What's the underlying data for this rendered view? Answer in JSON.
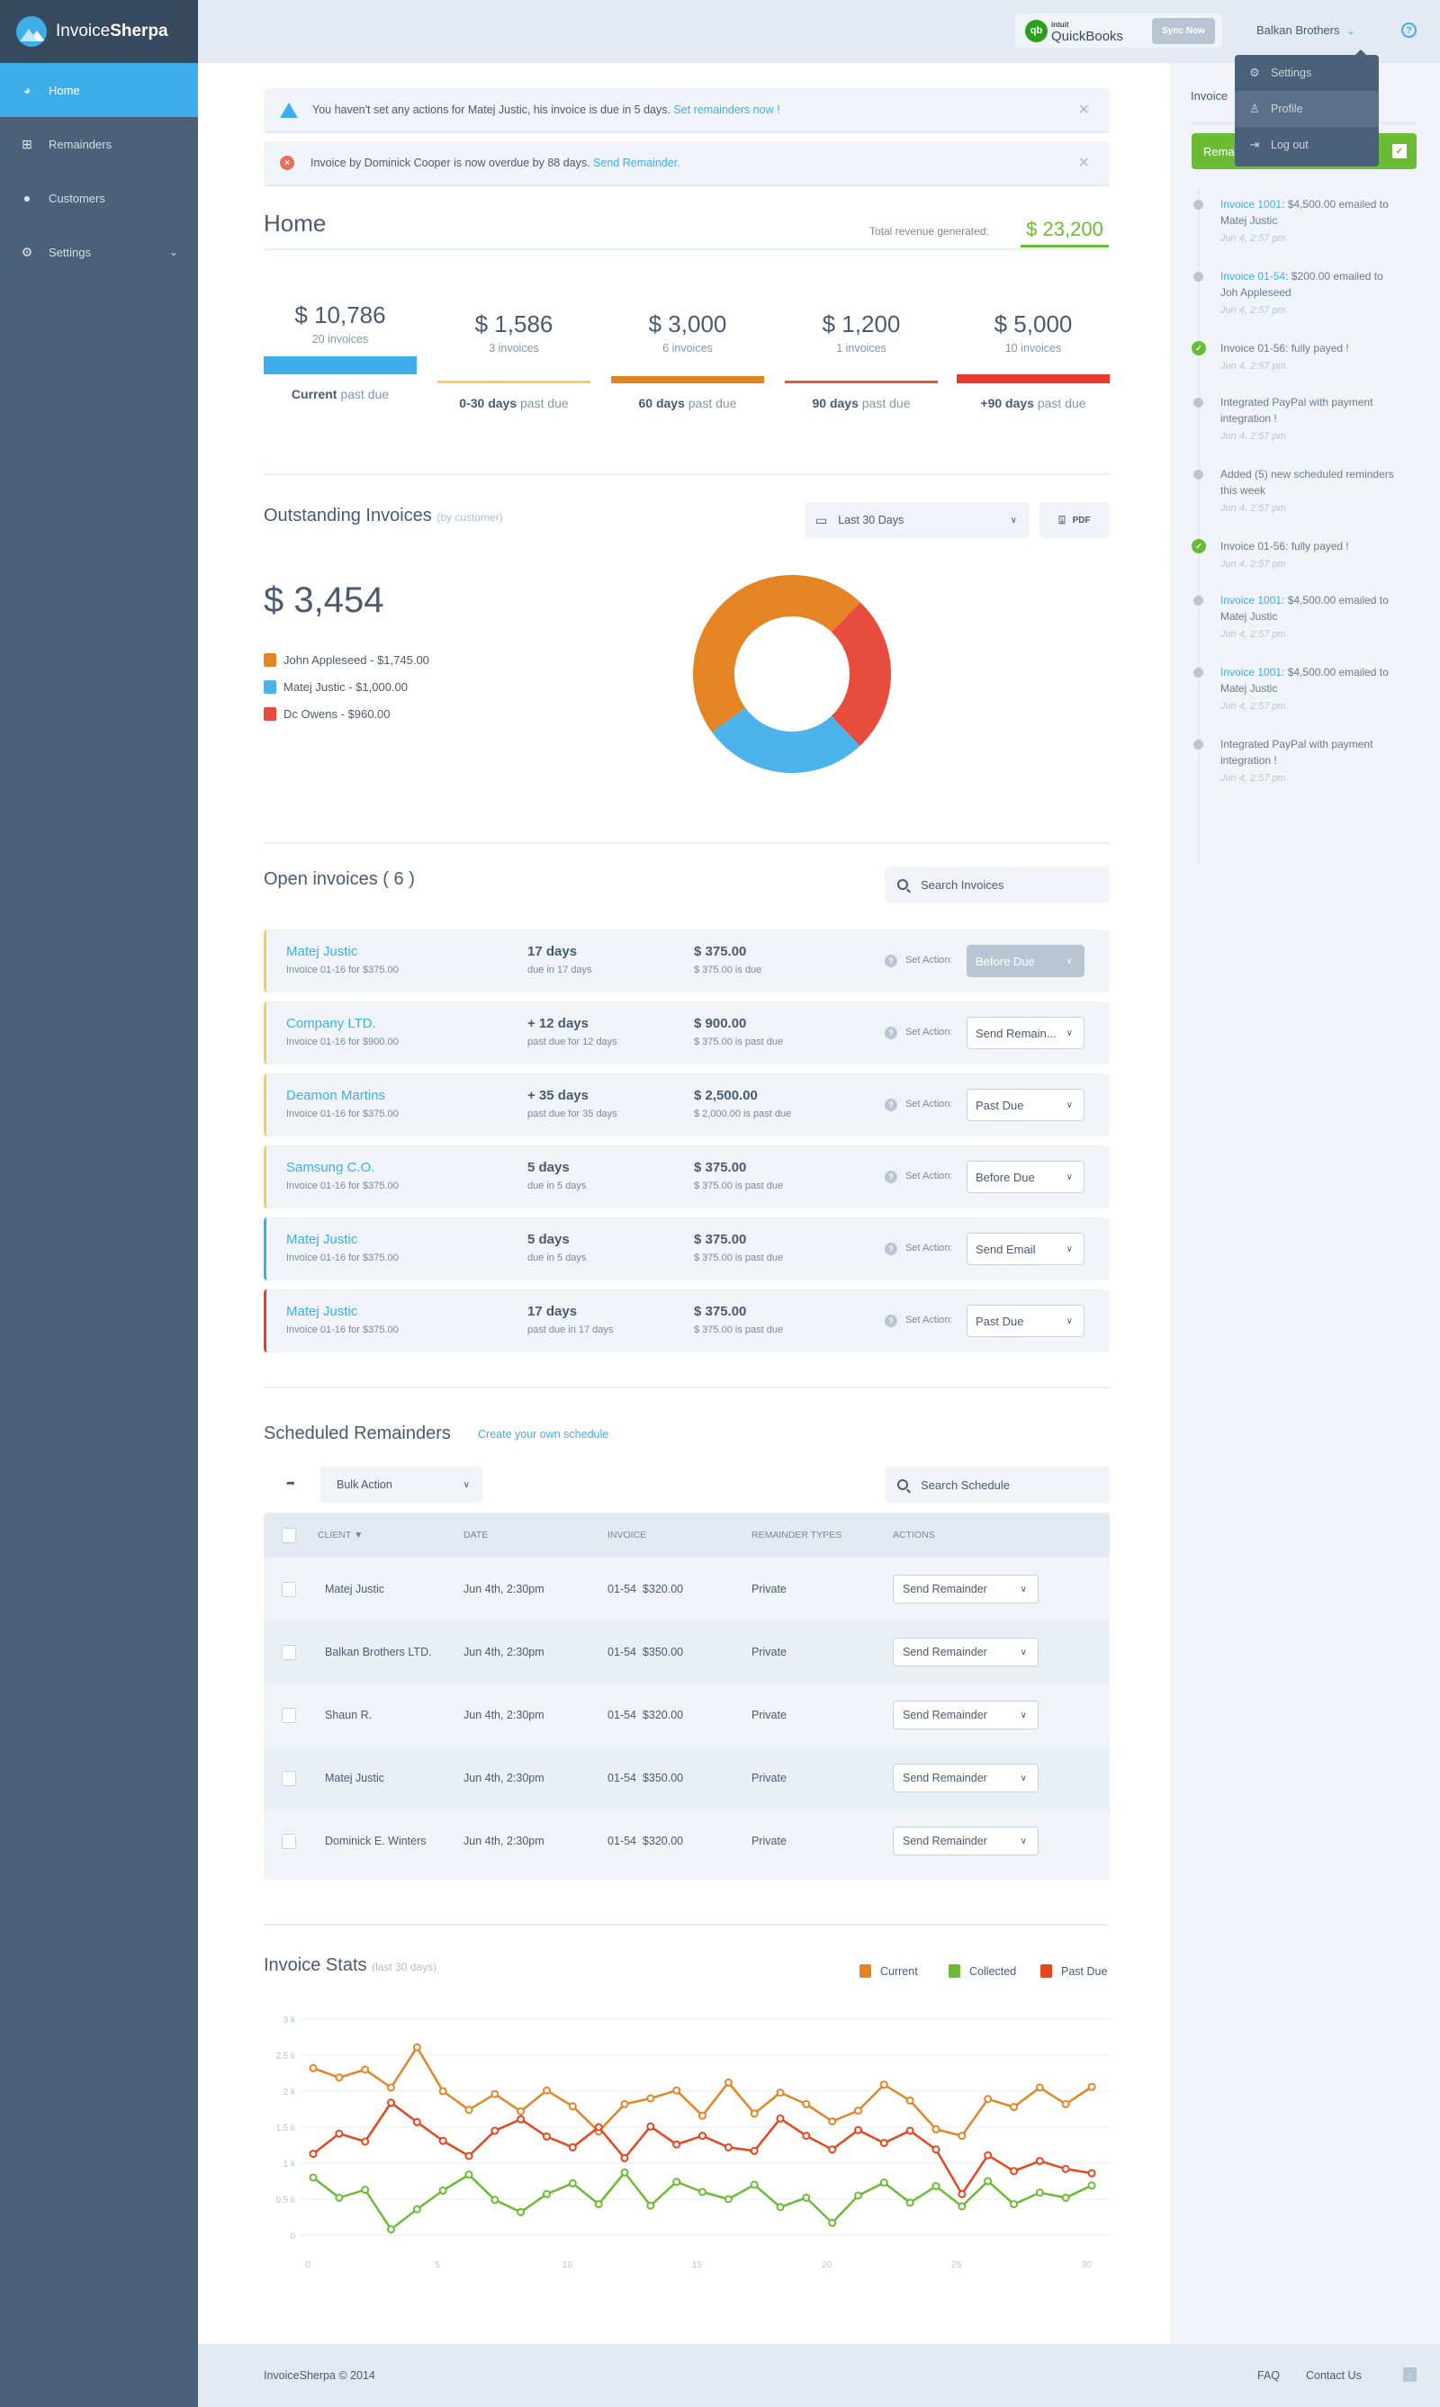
{
  "app": {
    "name_light": "Invoice",
    "name_bold": "Sherpa"
  },
  "sidebar": {
    "items": [
      {
        "label": "Home",
        "icon": "dashboard-icon",
        "active": true
      },
      {
        "label": "Remainders",
        "icon": "inbox-icon"
      },
      {
        "label": "Customers",
        "icon": "user-icon"
      },
      {
        "label": "Settings",
        "icon": "gear-icon",
        "has_submenu": true
      }
    ]
  },
  "topbar": {
    "quickbooks_small": "intuit",
    "quickbooks": "QuickBooks",
    "qb_glyph": "qb",
    "sync_label": "Sync Now",
    "user_name": "Balkan Brothers",
    "help": "?"
  },
  "user_menu": {
    "items": [
      {
        "label": "Settings",
        "icon": "gear-icon"
      },
      {
        "label": "Profile",
        "icon": "user-icon",
        "hover": true
      },
      {
        "label": "Log out",
        "icon": "logout-icon"
      }
    ]
  },
  "alerts": [
    {
      "type": "warning",
      "text": "You haven't set any actions for Matej Justic, his invoice is due in 5 days. ",
      "link": "Set remainders now !"
    },
    {
      "type": "error",
      "text": "Invoice by Dominick Cooper is now overdue by 88 days. ",
      "link": "Send Remainder."
    }
  ],
  "home": {
    "title": "Home",
    "revenue_label": "Total revenue generated:",
    "revenue_value": "$ 23,200",
    "buckets": [
      {
        "amount": "$ 10,786",
        "count": "20 invoices",
        "bold": "Current",
        "rest": " past due",
        "color": "#3daee9"
      },
      {
        "amount": "$ 1,586",
        "count": "3 invoices",
        "bold": "0-30 days",
        "rest": " past due",
        "color": "#f2ce5c"
      },
      {
        "amount": "$ 3,000",
        "count": "6 invoices",
        "bold": "60 days",
        "rest": " past due",
        "color": "#e58425"
      },
      {
        "amount": "$ 1,200",
        "count": "1 invoices",
        "bold": "90 days",
        "rest": " past due",
        "color": "#e85a32"
      },
      {
        "amount": "$ 5,000",
        "count": "10 invoices",
        "bold": "+90 days",
        "rest": " past due",
        "color": "#e8392b"
      }
    ]
  },
  "outstanding": {
    "title": "Outstanding Invoices",
    "subtitle": "(by customer)",
    "range_label": "Last 30 Days",
    "pdf_label": "PDF",
    "total": "$ 3,454",
    "legend": [
      {
        "label": "John Appleseed - $1,745.00",
        "color": "#e58425"
      },
      {
        "label": "Matej Justic - $1,000.00",
        "color": "#4cb4ea"
      },
      {
        "label": "Dc Owens - $960.00",
        "color": "#e84c3d"
      }
    ]
  },
  "chart_data": [
    {
      "type": "pie",
      "title": "Outstanding Invoices (by customer)",
      "donut": true,
      "categories": [
        "John Appleseed",
        "Matej Justic",
        "Dc Owens"
      ],
      "values": [
        1745,
        1000,
        960
      ],
      "colors": [
        "#e58425",
        "#4cb4ea",
        "#e84c3d"
      ]
    },
    {
      "type": "line",
      "title": "Invoice Stats",
      "subtitle": "(last 30 days)",
      "legend_position": "top-right",
      "x": [
        0,
        1,
        2,
        3,
        4,
        5,
        6,
        7,
        8,
        9,
        10,
        11,
        12,
        13,
        14,
        15,
        16,
        17,
        18,
        19,
        20,
        21,
        22,
        23,
        24,
        25,
        26,
        27,
        28,
        29,
        30
      ],
      "xticks": [
        "0",
        "5",
        "10",
        "15",
        "20",
        "25",
        "30"
      ],
      "yticks": [
        "0",
        "0.5 k",
        "1 k",
        "1.5 k",
        "2 k",
        "2.5 k",
        "3 k"
      ],
      "ylim": [
        0,
        3000
      ],
      "grid": true,
      "series": [
        {
          "name": "Current",
          "color": "#e58425",
          "values": [
            2320,
            2190,
            2300,
            2050,
            2610,
            2000,
            1740,
            1960,
            1720,
            2010,
            1790,
            1440,
            1820,
            1900,
            2010,
            1660,
            2120,
            1690,
            1980,
            1820,
            1580,
            1730,
            2090,
            1870,
            1470,
            1380,
            1890,
            1780,
            2050,
            1820,
            2060
          ]
        },
        {
          "name": "Collected",
          "color": "#6cbb35",
          "values": [
            800,
            520,
            630,
            80,
            360,
            620,
            840,
            490,
            320,
            570,
            720,
            430,
            870,
            410,
            740,
            600,
            500,
            700,
            390,
            520,
            170,
            550,
            730,
            450,
            680,
            400,
            750,
            430,
            590,
            520,
            690
          ]
        },
        {
          "name": "Past Due",
          "color": "#e8451e",
          "values": [
            1130,
            1410,
            1300,
            1840,
            1570,
            1310,
            1100,
            1450,
            1610,
            1370,
            1220,
            1500,
            1070,
            1510,
            1260,
            1380,
            1220,
            1170,
            1620,
            1380,
            1190,
            1460,
            1280,
            1450,
            1190,
            570,
            1110,
            890,
            1030,
            920,
            860
          ]
        }
      ]
    }
  ],
  "open_invoices": {
    "title": "Open invoices ( 6 )",
    "search_placeholder": "Search Invoices",
    "set_action_label": "Set Action:",
    "rows": [
      {
        "name": "Matej Justic",
        "sub": "Invoice 01-16 for $375.00",
        "days": "17 days",
        "days_sub": "due in 17 days",
        "amount": "$ 375.00",
        "amount_sub": "$ 375.00 is due",
        "action": "Before Due",
        "disabled": true,
        "accent": "#f2ce5c"
      },
      {
        "name": "Company LTD.",
        "sub": "Invoice 01-16 for $900.00",
        "days": "+ 12 days",
        "days_sub": "past due for 12 days",
        "amount": "$ 900.00",
        "amount_sub": "$ 375.00 is past due",
        "action": "Send Remain...",
        "accent": "#f2ce5c"
      },
      {
        "name": "Deamon Martins",
        "sub": "Invoice 01-16 for $375.00",
        "days": "+ 35 days",
        "days_sub": "past due for 35 days",
        "amount": "$ 2,500.00",
        "amount_sub": "$ 2,000.00 is past due",
        "action": "Past Due",
        "accent": "#f2ce5c"
      },
      {
        "name": "Samsung C.O.",
        "sub": "Invoice 01-16 for $375.00",
        "days": "5 days",
        "days_sub": "due in 5 days",
        "amount": "$ 375.00",
        "amount_sub": "$ 375.00 is past due",
        "action": "Before Due",
        "accent": "#f2ce5c"
      },
      {
        "name": "Matej Justic",
        "sub": "Invoice 01-16 for $375.00",
        "days": "5 days",
        "days_sub": "due in 5 days",
        "amount": "$ 375.00",
        "amount_sub": "$ 375.00 is past due",
        "action": "Send Email",
        "accent": "#3daee9"
      },
      {
        "name": "Matej Justic",
        "sub": "Invoice 01-16 for $375.00",
        "days": "17 days",
        "days_sub": "past due in 17 days",
        "amount": "$ 375.00",
        "amount_sub": "$ 375.00 is past due",
        "action": "Past Due",
        "accent": "#e8392b"
      }
    ]
  },
  "scheduled": {
    "title": "Scheduled Remainders",
    "create_link": "Create your own schedule",
    "bulk_label": "Bulk Action",
    "search_placeholder": "Search Schedule",
    "columns": [
      "CLIENT",
      "DATE",
      "INVOICE",
      "REMAINDER TYPES",
      "ACTIONS"
    ],
    "sort_indicator": "▼",
    "rows": [
      {
        "client": "Matej Justic",
        "date": "Jun 4th, 2:30pm",
        "invoice": "01-54  $320.00",
        "type": "Private",
        "action": "Send Remainder"
      },
      {
        "client": "Balkan Brothers LTD.",
        "date": "Jun 4th, 2:30pm",
        "invoice": "01-54  $350.00",
        "type": "Private",
        "action": "Send Remainder"
      },
      {
        "client": "Shaun R.",
        "date": "Jun 4th, 2:30pm",
        "invoice": "01-54  $320.00",
        "type": "Private",
        "action": "Send Remainder"
      },
      {
        "client": "Matej Justic",
        "date": "Jun 4th, 2:30pm",
        "invoice": "01-54  $350.00",
        "type": "Private",
        "action": "Send Remainder"
      },
      {
        "client": "Dominick E. Winters",
        "date": "Jun 4th, 2:30pm",
        "invoice": "01-54  $320.00",
        "type": "Private",
        "action": "Send Remainder"
      }
    ]
  },
  "stats": {
    "title": "Invoice Stats",
    "subtitle": "(last 30 days)"
  },
  "right_panel": {
    "title": "Invoice",
    "button_label": "Rema",
    "timeline": [
      {
        "link": "Invoice 1001",
        "text": ": $4,500.00 emailed to Matej Justic",
        "time": "Jun 4, 2:57 pm",
        "status": "dot"
      },
      {
        "link": "Invoice 01-54",
        "text": ": $200.00 emailed to Joh Appleseed",
        "time": "Jun 4, 2:57 pm",
        "status": "dot"
      },
      {
        "link": "",
        "text": "Invoice 01-56: fully payed !",
        "time": "Jun 4, 2:57 pm",
        "status": "ok"
      },
      {
        "link": "",
        "text": "Integrated PayPal with payment integration !",
        "time": "Jun 4, 2:57 pm",
        "status": "dot"
      },
      {
        "link": "",
        "text": "Added (5) new scheduled reminders this week",
        "time": "Jun 4, 2:57 pm",
        "status": "dot"
      },
      {
        "link": "",
        "text": "Invoice 01-56: fully payed !",
        "time": "Jun 4, 2:57 pm",
        "status": "ok"
      },
      {
        "link": "Invoice 1001",
        "text": ": $4,500.00 emailed to Matej Justic",
        "time": "Jun 4, 2:57 pm",
        "status": "dot"
      },
      {
        "link": "Invoice 1001",
        "text": ": $4,500.00 emailed to Matej Justic",
        "time": "Jun 4, 2:57 pm",
        "status": "dot"
      },
      {
        "link": "",
        "text": "Integrated PayPal with payment integration !",
        "time": "Jun 4, 2:57 pm",
        "status": "dot"
      }
    ]
  },
  "footer": {
    "copyright": "InvoiceSherpa © 2014",
    "faq": "FAQ",
    "contact": "Contact Us",
    "up": "↑"
  }
}
